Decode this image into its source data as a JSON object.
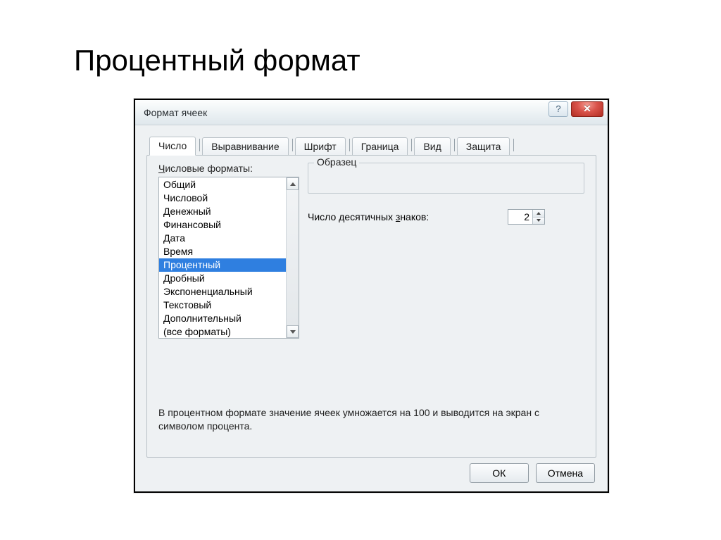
{
  "page_title": "Процентный формат",
  "dialog": {
    "title": "Формат ячеек",
    "help_label": "?",
    "close_label": "✕",
    "tabs": [
      {
        "label": "Число"
      },
      {
        "label": "Выравнивание"
      },
      {
        "label": "Шрифт"
      },
      {
        "label": "Граница"
      },
      {
        "label": "Вид"
      },
      {
        "label": "Защита"
      }
    ],
    "formats_label_pre": "Ч",
    "formats_label_rest": "исловые форматы:",
    "format_items": [
      "Общий",
      "Числовой",
      "Денежный",
      "Финансовый",
      "Дата",
      "Время",
      "Процентный",
      "Дробный",
      "Экспоненциальный",
      "Текстовый",
      "Дополнительный",
      "(все форматы)"
    ],
    "selected_index": 6,
    "sample_label": "Образец",
    "decimal_label_pre": "Число десятичных ",
    "decimal_label_u": "з",
    "decimal_label_post": "наков:",
    "decimal_value": "2",
    "description": "В процентном формате значение ячеек умножается на 100 и выводится на экран с символом процента.",
    "ok_label": "ОК",
    "cancel_label": "Отмена"
  }
}
